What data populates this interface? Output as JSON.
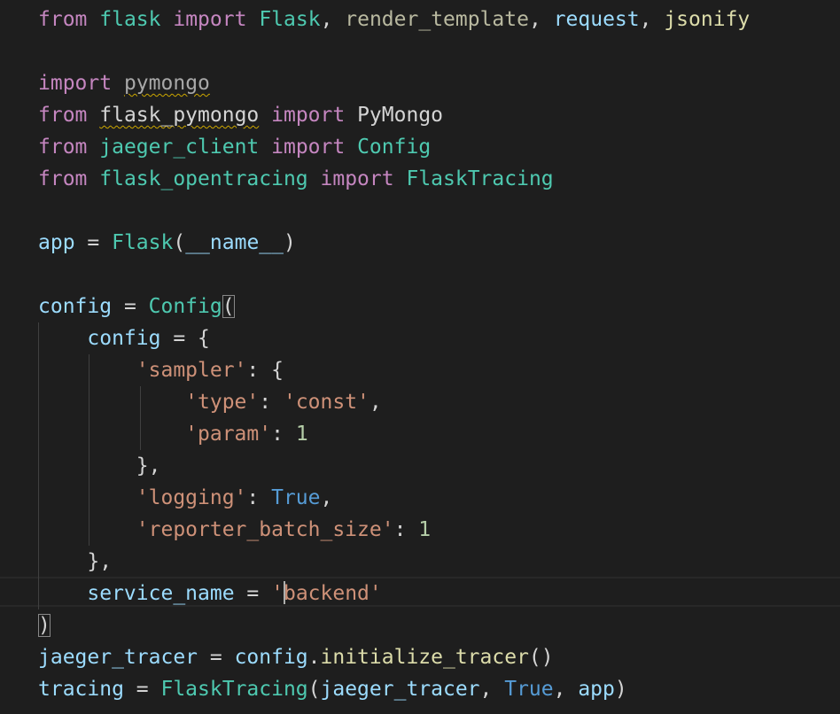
{
  "theme": {
    "background": "#1e1e1e",
    "keyword": "#c586c0",
    "module": "#4ec9b0",
    "function": "#dcdcaa",
    "variable": "#9cdcfe",
    "string": "#ce9178",
    "number": "#b5cea8",
    "constant": "#569cd6",
    "plain": "#d4d4d4",
    "warning_squiggle": "#cca700"
  },
  "code": {
    "l1": {
      "from": "from",
      "mod": "flask",
      "import": "import",
      "cls": "Flask",
      "c1": ", ",
      "fn": "render_template",
      "c2": ", ",
      "v1": "request",
      "c3": ", ",
      "v2": "jsonify"
    },
    "l3": {
      "import": "import",
      "mod": "pymongo"
    },
    "l4": {
      "from": "from",
      "mod": "flask_pymongo",
      "import": "import",
      "cls": "PyMongo"
    },
    "l5": {
      "from": "from",
      "mod": "jaeger_client",
      "import": "import",
      "cls": "Config"
    },
    "l6": {
      "from": "from",
      "mod": "flask_opentracing",
      "import": "import",
      "cls": "FlaskTracing"
    },
    "l8": {
      "var": "app",
      "eq": " = ",
      "cls": "Flask",
      "open": "(",
      "arg": "__name__",
      "close": ")"
    },
    "l10": {
      "var": "config",
      "eq": " = ",
      "cls": "Config",
      "open": "("
    },
    "l11": {
      "var": "config",
      "rest": " = {"
    },
    "l12": {
      "key": "'sampler'",
      "rest": ": {"
    },
    "l13": {
      "key": "'type'",
      "colon": ": ",
      "val": "'const'",
      "comma": ","
    },
    "l14": {
      "key": "'param'",
      "colon": ": ",
      "num": "1"
    },
    "l15": {
      "text": "},"
    },
    "l16": {
      "key": "'logging'",
      "colon": ": ",
      "const": "True",
      "comma": ","
    },
    "l17": {
      "key": "'reporter_batch_size'",
      "colon": ": ",
      "num": "1"
    },
    "l18": {
      "text": "},"
    },
    "l19": {
      "var": "service_name",
      "eq": " = ",
      "q1": "'",
      "str": "backend'"
    },
    "l20": {
      "close": ")"
    },
    "l21": {
      "var": "jaeger_tracer",
      "eq": " = ",
      "obj": "config",
      "dot": ".",
      "fn": "initialize_tracer",
      "parens": "()"
    },
    "l22": {
      "var": "tracing",
      "eq": " = ",
      "cls": "FlaskTracing",
      "open": "(",
      "a1": "jaeger_tracer",
      "c1": ", ",
      "a2": "True",
      "c2": ", ",
      "a3": "app",
      "close": ")"
    }
  }
}
